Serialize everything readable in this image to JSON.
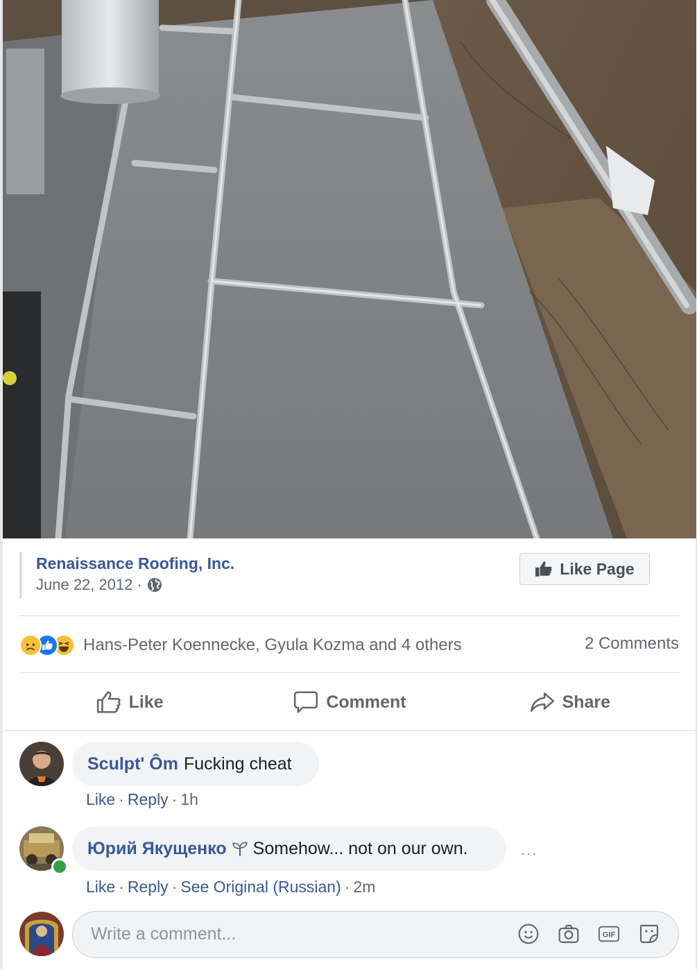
{
  "post": {
    "page_name": "Renaissance Roofing, Inc.",
    "date": "June 22, 2012",
    "date_separator": "·",
    "like_page_label": "Like Page"
  },
  "reactions": {
    "icons": [
      "sad-reaction",
      "like-reaction",
      "haha-reaction"
    ],
    "names": "Hans-Peter Koennecke, Gyula Kozma and 4 others",
    "comments_count": "2 Comments"
  },
  "actions": {
    "like": "Like",
    "comment": "Comment",
    "share": "Share"
  },
  "comments": [
    {
      "author": "Sculpt' Ôm",
      "text": "Fucking cheat",
      "like": "Like",
      "reply": "Reply",
      "time": "1h"
    },
    {
      "author": "Юрий Якущенко",
      "text": "Somehow... not on our own.",
      "like": "Like",
      "reply": "Reply",
      "see_original": "See Original (Russian)",
      "time": "2m",
      "more": "···"
    }
  ],
  "composer": {
    "placeholder": "Write a comment...",
    "gif_label": "GIF"
  },
  "colors": {
    "link_blue": "#385898",
    "muted_gray": "#606770",
    "like_blue": "#1877f2",
    "online_green": "#31a24c"
  }
}
